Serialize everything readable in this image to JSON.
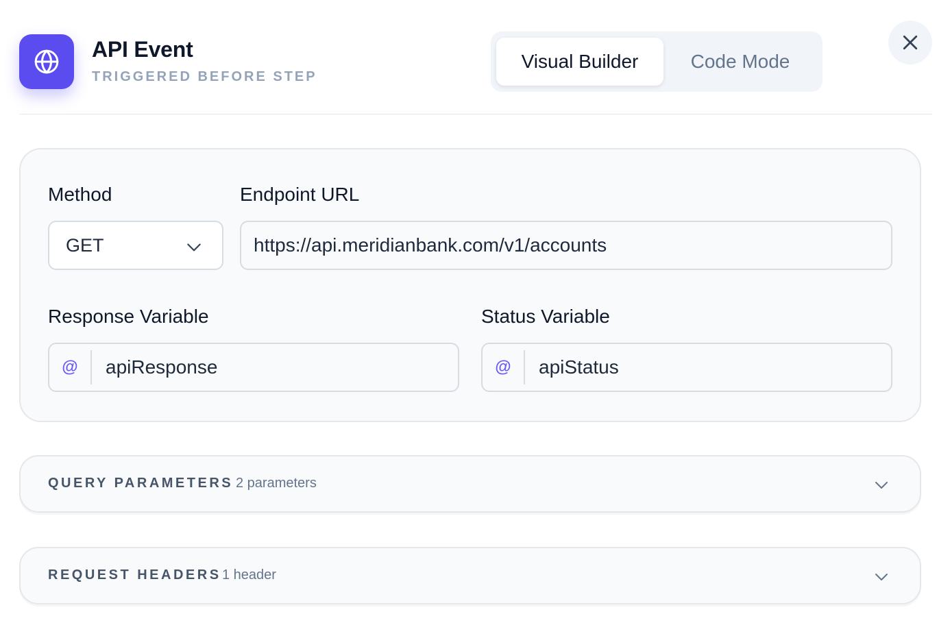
{
  "header": {
    "title": "API Event",
    "subtitle": "TRIGGERED BEFORE STEP",
    "icon": "globe-icon",
    "accent_color": "#5b4cf0"
  },
  "mode_toggle": {
    "options": [
      {
        "label": "Visual Builder",
        "active": true
      },
      {
        "label": "Code Mode",
        "active": false
      }
    ]
  },
  "close": {
    "icon": "close-icon"
  },
  "form": {
    "method": {
      "label": "Method",
      "value": "GET"
    },
    "endpoint": {
      "label": "Endpoint URL",
      "value": "https://api.meridianbank.com/v1/accounts"
    },
    "response_variable": {
      "label": "Response Variable",
      "prefix": "@",
      "value": "apiResponse"
    },
    "status_variable": {
      "label": "Status Variable",
      "prefix": "@",
      "value": "apiStatus"
    }
  },
  "sections": {
    "query_parameters": {
      "title": "QUERY PARAMETERS",
      "count": "2 parameters"
    },
    "request_headers": {
      "title": "REQUEST HEADERS",
      "count": "1 header"
    }
  }
}
